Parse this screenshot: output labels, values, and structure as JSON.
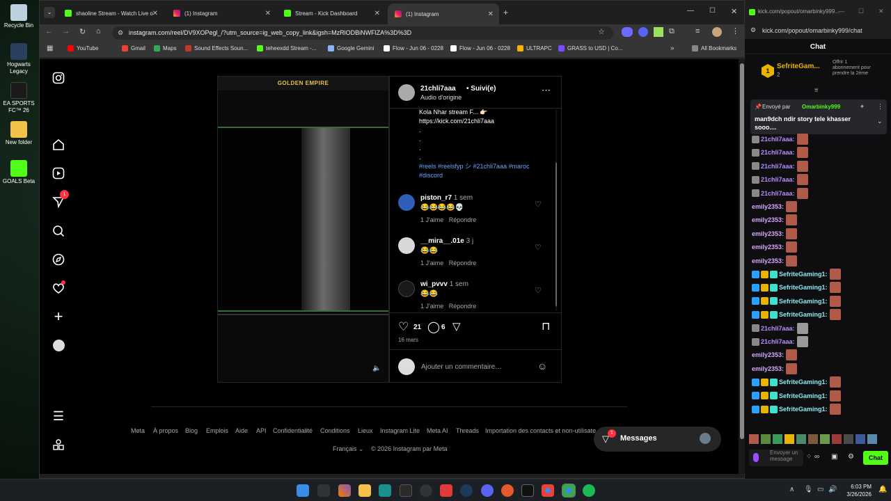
{
  "desktop": {
    "icons": [
      {
        "label": "Recycle Bin",
        "icon": "recycle-bin-icon"
      },
      {
        "label": "Hogwarts Legacy",
        "icon": "hogwarts-legacy-icon"
      },
      {
        "label": "EA SPORTS FC™ 26",
        "icon": "ea-sports-fc-icon"
      },
      {
        "label": "New folder",
        "icon": "folder-icon"
      },
      {
        "label": "GOALS Beta",
        "icon": "goals-beta-icon"
      }
    ]
  },
  "browser": {
    "tabs": [
      {
        "label": "shaoline Stream - Watch Live o",
        "icon": "kick-icon"
      },
      {
        "label": "(1) Instagram",
        "icon": "instagram-icon"
      },
      {
        "label": "Stream - Kick Dashboard",
        "icon": "kick-icon"
      },
      {
        "label": "(1) Instagram",
        "icon": "instagram-icon"
      }
    ],
    "url": "instagram.com/reel/DV9XOPegl_/?utm_source=ig_web_copy_link&igsh=MzRlODBiNWFlZA%3D%3D",
    "bookmarks": [
      {
        "label": "YouTube",
        "color": "#ff0000"
      },
      {
        "label": "Gmail",
        "color": "#ea4335"
      },
      {
        "label": "Maps",
        "color": "#34a853"
      },
      {
        "label": "Sound Effects Soun...",
        "color": "#c0392b"
      },
      {
        "label": "teheexdd Stream -...",
        "color": "#53fc18"
      },
      {
        "label": "Google Gemini",
        "color": "#8ab4f8"
      },
      {
        "label": "Flow - Jun 06 - 0228",
        "color": "#ffffff"
      },
      {
        "label": "Flow - Jun 06 - 0228",
        "color": "#ffffff"
      },
      {
        "label": "ULTRAPC",
        "color": "#f5b400"
      },
      {
        "label": "GRASS to USD | Co...",
        "color": "#7b4bff"
      }
    ],
    "all_bookmarks": "All Bookmarks"
  },
  "instagram": {
    "nav_badge": "1",
    "video": {
      "banner": "GOLDEN EMPIRE"
    },
    "post": {
      "username": "21chli7aaa",
      "follow": "• Suivi(e)",
      "audio": "Audio d'origine",
      "caption_lines": [
        "Kola Nhar stream F... 👉🏻",
        "https://kick.com/21chli7aaa",
        ".",
        ".",
        ".",
        "."
      ],
      "hashtags": "#reels #reelsfyp シ #21chli7aaa #maroc #discord",
      "likes": "21",
      "comments_count": "6",
      "date": "16 mars",
      "comment_placeholder": "Ajouter un commentaire…"
    },
    "comments": [
      {
        "user": "piston_r7",
        "time": "1 sem",
        "text": "😂😂😂😂💀",
        "likes": "1 J'aime",
        "reply": "Répondre"
      },
      {
        "user": "__mira__.01e",
        "time": "3 j",
        "text": "😂😂",
        "likes": "1 J'aime",
        "reply": "Répondre"
      },
      {
        "user": "wi_pvvv",
        "time": "1 sem",
        "text": "😂😂",
        "likes": "1 J'aime",
        "reply": "Répondre"
      }
    ],
    "footer_links": [
      "Meta",
      "À propos",
      "Blog",
      "Emplois",
      "Aide",
      "API",
      "Confidentialité",
      "Conditions",
      "Lieux",
      "Instagram Lite",
      "Meta AI",
      "Threads",
      "Importation des contacts et non-utilisate"
    ],
    "language": "Français",
    "copyright": "© 2026 Instagram par Meta",
    "messages": {
      "label": "Messages",
      "badge": "1"
    }
  },
  "chat": {
    "window_url": "kick.com/popout/omarbinky999...",
    "url": "kick.com/popout/omarbinky999/chat",
    "title": "Chat",
    "sub": {
      "name": "SefriteGam...",
      "count": "2",
      "offer": "Offrir 1 abonnement pour prendre la 2ème",
      "rank": "1"
    },
    "pinned": {
      "by": "Envoyé par",
      "user": "Omarbinky999",
      "text": "man9dch ndir story tele khasser sooo...."
    },
    "messages": [
      {
        "user": "21chli7aaa:",
        "color": "#b78bff"
      },
      {
        "user": "21chli7aaa:",
        "color": "#b78bff"
      },
      {
        "user": "21chli7aaa:",
        "color": "#b78bff"
      },
      {
        "user": "21chli7aaa:",
        "color": "#b78bff"
      },
      {
        "user": "21chli7aaa:",
        "color": "#b78bff"
      },
      {
        "user": "emily2353:",
        "color": "#d9a7ff"
      },
      {
        "user": "emily2353:",
        "color": "#d9a7ff"
      },
      {
        "user": "emily2353:",
        "color": "#d9a7ff"
      },
      {
        "user": "emily2353:",
        "color": "#d9a7ff"
      },
      {
        "user": "emily2353:",
        "color": "#d9a7ff"
      },
      {
        "user": "SefriteGaming1:",
        "color": "#8ee8f0"
      },
      {
        "user": "SefriteGaming1:",
        "color": "#8ee8f0"
      },
      {
        "user": "SefriteGaming1:",
        "color": "#8ee8f0"
      },
      {
        "user": "SefriteGaming1:",
        "color": "#8ee8f0"
      },
      {
        "user": "21chli7aaa:",
        "color": "#b78bff"
      },
      {
        "user": "21chli7aaa:",
        "color": "#b78bff"
      },
      {
        "user": "emily2353:",
        "color": "#d9a7ff"
      },
      {
        "user": "emily2353:",
        "color": "#d9a7ff"
      },
      {
        "user": "SefriteGaming1:",
        "color": "#8ee8f0"
      },
      {
        "user": "SefriteGaming1:",
        "color": "#8ee8f0"
      },
      {
        "user": "SefriteGaming1:",
        "color": "#8ee8f0"
      }
    ],
    "input_placeholder": "Envoyer un message",
    "send": "Chat"
  },
  "taskbar": {
    "time": "6:03 PM",
    "date": "3/26/2026"
  },
  "colors": {
    "kick_green": "#53fc18",
    "instagram_blue": "#4a9eff",
    "badge_red": "#ff3040"
  }
}
